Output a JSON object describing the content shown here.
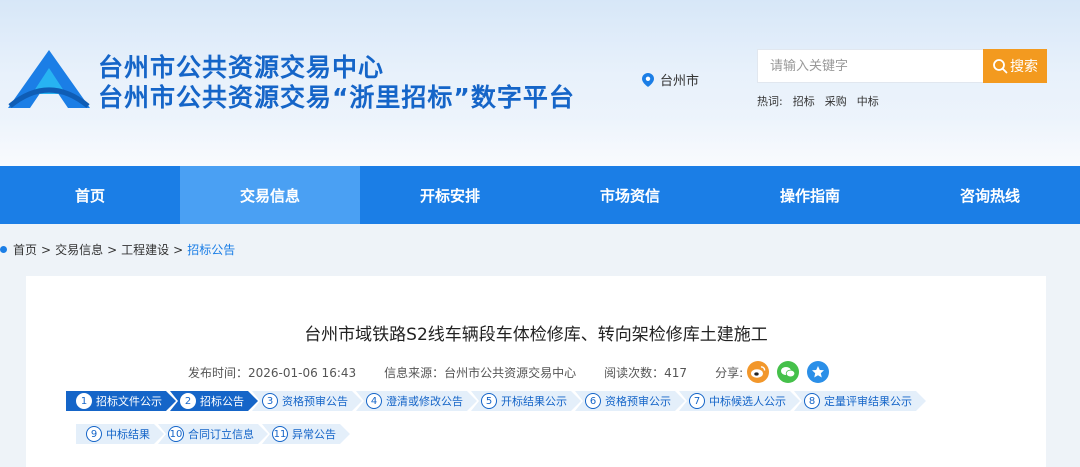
{
  "header": {
    "title_line1": "台州市公共资源交易中心",
    "title_line2": "台州市公共资源交易“浙里招标”数字平台",
    "location": "台州市",
    "search_placeholder": "请输入关键字",
    "search_button": "搜索",
    "hot_label": "热词:",
    "hot_words": [
      "招标",
      "采购",
      "中标"
    ],
    "colors": {
      "brand": "#1565c8",
      "accent": "#f39a1f"
    }
  },
  "nav": {
    "items": [
      "首页",
      "交易信息",
      "开标安排",
      "市场资信",
      "操作指南",
      "咨询热线"
    ],
    "active_index": 1
  },
  "breadcrumb": {
    "items": [
      "首页",
      "交易信息",
      "工程建设",
      "招标公告"
    ],
    "separator": ">"
  },
  "article": {
    "title": "台州市域铁路S2线车辆段车体检修库、转向架检修库土建施工",
    "publish_time": "发布时间：2026-01-06 16:43",
    "source": "信息来源：台州市公共资源交易中心",
    "views": "阅读次数：417",
    "share_label": "分享:",
    "share_icons": [
      "weibo-icon",
      "wechat-icon",
      "qzone-star-icon"
    ]
  },
  "steps": {
    "row1": [
      {
        "num": "1",
        "label": "招标文件公示",
        "done": true
      },
      {
        "num": "2",
        "label": "招标公告",
        "done": true
      },
      {
        "num": "3",
        "label": "资格预审公告",
        "done": false
      },
      {
        "num": "4",
        "label": "澄清或修改公告",
        "done": false
      },
      {
        "num": "5",
        "label": "开标结果公示",
        "done": false
      },
      {
        "num": "6",
        "label": "资格预审公示",
        "done": false
      },
      {
        "num": "7",
        "label": "中标候选人公示",
        "done": false
      },
      {
        "num": "8",
        "label": "定量评审结果公示",
        "done": false
      }
    ],
    "row2": [
      {
        "num": "9",
        "label": "中标结果",
        "done": false
      },
      {
        "num": "10",
        "label": "合同订立信息",
        "done": false
      },
      {
        "num": "11",
        "label": "异常公告",
        "done": false
      }
    ]
  }
}
